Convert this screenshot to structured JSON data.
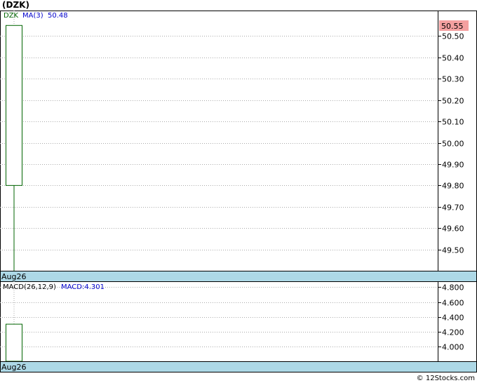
{
  "title": "(DZK)",
  "footer": "© 12Stocks.com",
  "colors": {
    "candle": "#006400",
    "legend_ticker": "#006400",
    "legend_ma": "#0000cc",
    "date_bar": "#add8e6",
    "grid": "#aaaaaa",
    "last_price_bg": "#f4a0a0",
    "border": "#000000"
  },
  "chart_data": [
    {
      "type": "candlestick",
      "panel": "price",
      "legend": {
        "ticker": "DZK",
        "ma_label": "MA(3)",
        "ma_value": "50.48"
      },
      "last_price_label": "50.55",
      "ylim": [
        49.4,
        50.62
      ],
      "yticks": [
        49.5,
        49.6,
        49.7,
        49.8,
        49.9,
        50.0,
        50.1,
        50.2,
        50.3,
        50.4,
        50.5
      ],
      "ytick_labels": [
        "49.50",
        "49.60",
        "49.70",
        "49.80",
        "49.90",
        "50.00",
        "50.10",
        "50.20",
        "50.30",
        "50.40",
        "50.50"
      ],
      "x_labels": [
        "Aug26"
      ],
      "candles": [
        {
          "date": "Aug26",
          "open": 49.8,
          "close": 50.55,
          "high": 50.55,
          "low": 49.4
        }
      ]
    },
    {
      "type": "bar",
      "panel": "macd",
      "legend": {
        "label": "MACD(26,12,9)",
        "value_label": "MACD:4.301"
      },
      "ylim": [
        3.8,
        4.88
      ],
      "yticks": [
        4.0,
        4.2,
        4.4,
        4.6,
        4.8
      ],
      "ytick_labels": [
        "4.000",
        "4.200",
        "4.400",
        "4.600",
        "4.800"
      ],
      "x_labels": [
        "Aug26"
      ],
      "bars": [
        {
          "date": "Aug26",
          "value": 4.301
        }
      ]
    }
  ]
}
